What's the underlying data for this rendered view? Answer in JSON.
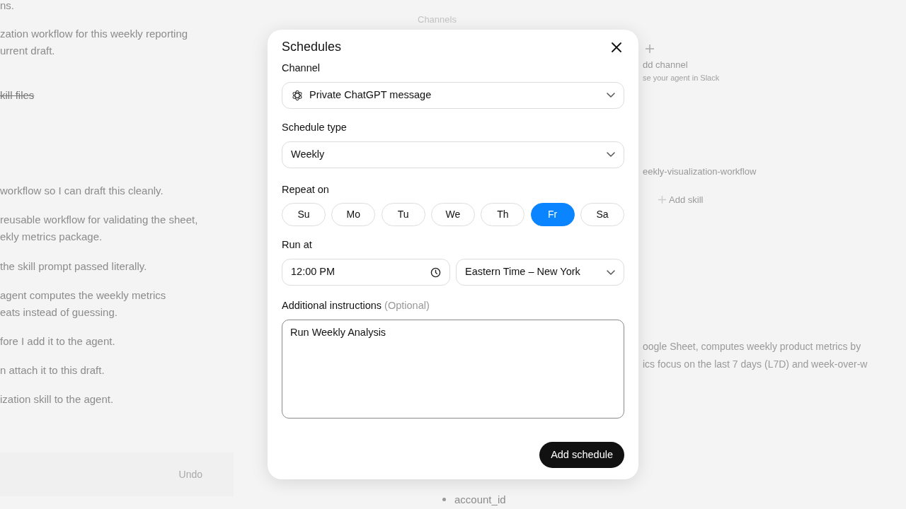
{
  "background": {
    "left_items": [
      {
        "kind": "text",
        "text": "ns."
      },
      {
        "kind": "text",
        "text": "zation workflow for this weekly reporting\nurrent draft."
      },
      {
        "kind": "struck",
        "text": "kill files"
      },
      {
        "kind": "text",
        "text": "workflow so I can draft this cleanly."
      },
      {
        "kind": "text",
        "text": "reusable workflow for validating the sheet,\nekly metrics package."
      },
      {
        "kind": "text",
        "text": "the skill prompt passed literally."
      },
      {
        "kind": "text",
        "text": "agent computes the weekly metrics\neats instead of guessing."
      },
      {
        "kind": "text",
        "text": "fore I add it to the agent."
      },
      {
        "kind": "text",
        "text": "n attach it to this draft."
      },
      {
        "kind": "text",
        "text": "ization skill to the agent."
      }
    ],
    "undo": "Undo",
    "channels_heading": "Channels",
    "add_channel": {
      "title": "dd channel",
      "subtitle": "se your agent in Slack"
    },
    "skill": "eekly-visualization-workflow",
    "add_skill": "Add skill",
    "description": "oogle Sheet, computes weekly product metrics by\nics focus on the last 7 days (L7D) and week-over-w",
    "bullets": [
      "account_id"
    ]
  },
  "dialog": {
    "title": "Schedules",
    "channel": {
      "label": "Channel",
      "value": "Private ChatGPT message"
    },
    "schedule_type": {
      "label": "Schedule type",
      "value": "Weekly"
    },
    "repeat_on": {
      "label": "Repeat on",
      "days": [
        {
          "label": "Su",
          "selected": false
        },
        {
          "label": "Mo",
          "selected": false
        },
        {
          "label": "Tu",
          "selected": false
        },
        {
          "label": "We",
          "selected": false
        },
        {
          "label": "Th",
          "selected": false
        },
        {
          "label": "Fr",
          "selected": true
        },
        {
          "label": "Sa",
          "selected": false
        }
      ]
    },
    "run_at": {
      "label": "Run at",
      "time": "12:00 PM",
      "timezone": "Eastern Time – New York"
    },
    "instructions": {
      "label": "Additional instructions",
      "hint": "(Optional)",
      "value": "Run Weekly Analysis"
    },
    "submit": "Add schedule"
  }
}
